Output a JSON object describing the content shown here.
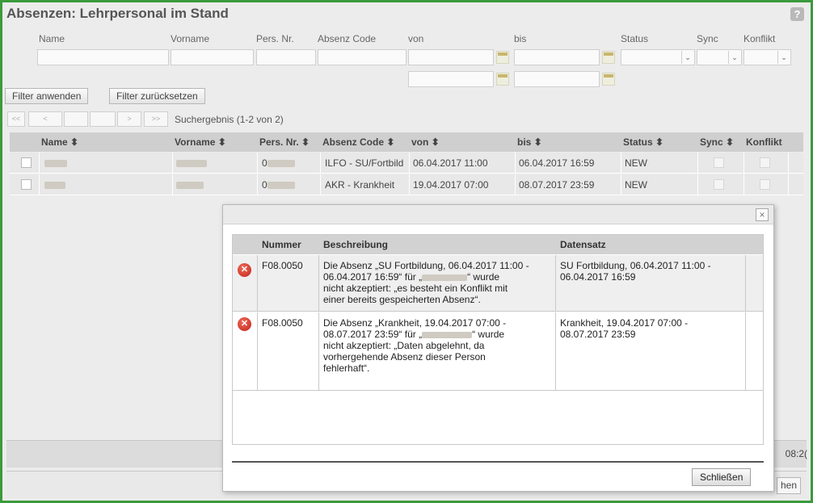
{
  "header": {
    "title": "Absenzen: Lehrpersonal im Stand",
    "help_icon": "?"
  },
  "filters": {
    "labels": {
      "name": "Name",
      "vorname": "Vorname",
      "pers_nr": "Pers. Nr.",
      "absenz_code": "Absenz Code",
      "von": "von",
      "bis": "bis",
      "status": "Status",
      "sync": "Sync",
      "konflikt": "Konflikt"
    },
    "apply_label": "Filter anwenden",
    "reset_label": "Filter zurücksetzen",
    "result_text": "Suchergebnis (1-2 von 2)"
  },
  "pager": {
    "first": "<<",
    "prev": "<",
    "next": ">",
    "last": ">>"
  },
  "grid": {
    "headers": {
      "name": "Name ⬍",
      "vorname": "Vorname ⬍",
      "pers_nr": "Pers. Nr. ⬍",
      "absenz_code": "Absenz Code ⬍",
      "von": "von ⬍",
      "bis": "bis ⬍",
      "status": "Status ⬍",
      "sync": "Sync ⬍",
      "konflikt": "Konflikt"
    },
    "rows": [
      {
        "pers_nr_prefix": "0",
        "absenz_code": "ILFO - SU/Fortbild",
        "von": "06.04.2017 11:00",
        "bis": "06.04.2017 16:59",
        "status": "NEW"
      },
      {
        "pers_nr_prefix": "0",
        "absenz_code": "AKR - Krankheit",
        "von": "19.04.2017 07:00",
        "bis": "08.07.2017 23:59",
        "status": "NEW"
      }
    ]
  },
  "background_peek": {
    "time_fragment": "08:2(",
    "button_fragment": "hen"
  },
  "dialog": {
    "close_icon": "×",
    "columns": {
      "nummer": "Nummer",
      "beschreibung": "Beschreibung",
      "datensatz": "Datensatz"
    },
    "messages": [
      {
        "nummer": "F08.0050",
        "beschreibung_l1": "Die Absenz „SU Fortbildung, 06.04.2017 11:00 -",
        "beschreibung_l2a": "06.04.2017 16:59“ für „",
        "beschreibung_l2b": "“ wurde",
        "beschreibung_l3": "nicht akzeptiert: „es besteht ein Konflikt mit",
        "beschreibung_l4": "einer bereits gespeicherten Absenz“.",
        "datensatz_l1": "SU Fortbildung, 06.04.2017 11:00 -",
        "datensatz_l2": "06.04.2017 16:59"
      },
      {
        "nummer": "F08.0050",
        "beschreibung_l1": "Die Absenz „Krankheit, 19.04.2017 07:00 -",
        "beschreibung_l2a": "08.07.2017 23:59“ für „",
        "beschreibung_l2b": "“ wurde",
        "beschreibung_l3": "nicht akzeptiert: „Daten abgelehnt, da",
        "beschreibung_l4": "vorhergehende Absenz dieser Person",
        "beschreibung_l5": "fehlerhaft“.",
        "datensatz_l1": "Krankheit, 19.04.2017 07:00 -",
        "datensatz_l2": "08.07.2017 23:59"
      }
    ],
    "close_button": "Schließen"
  },
  "colors": {
    "frame_green": "#3b9a3b",
    "error_red": "#c0241a"
  }
}
